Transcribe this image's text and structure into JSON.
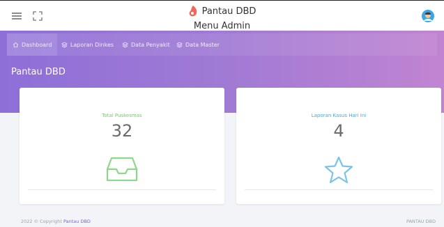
{
  "header": {
    "brand_name": "Pantau DBD",
    "subtitle": "Menu Admin",
    "icons": {
      "menu": "hamburger-menu-icon",
      "fullscreen": "fullscreen-icon",
      "logo": "mosquito-logo-icon",
      "avatar": "user-avatar-icon"
    }
  },
  "nav": {
    "items": [
      {
        "label": "Dashboard",
        "icon": "home-icon"
      },
      {
        "label": "Laporan Dinkes",
        "icon": "layers-icon"
      },
      {
        "label": "Data Penyakit",
        "icon": "layers-icon"
      },
      {
        "label": "Data Master",
        "icon": "layers-icon"
      }
    ]
  },
  "page": {
    "title": "Pantau DBD"
  },
  "cards": [
    {
      "label": "Total Puskesmas",
      "value": "32",
      "label_color": "#7dc472",
      "icon": "inbox-icon",
      "icon_color": "#8ed68a"
    },
    {
      "label": "Laporan Kasus Hari Ini",
      "value": "4",
      "label_color": "#4aa8d8",
      "icon": "star-icon",
      "icon_color": "#7dc4e4"
    }
  ],
  "footer": {
    "copyright_prefix": "2022 © Copyright",
    "copyright_link": "Pantau DBD",
    "right_text": "PANTAU DBD"
  }
}
